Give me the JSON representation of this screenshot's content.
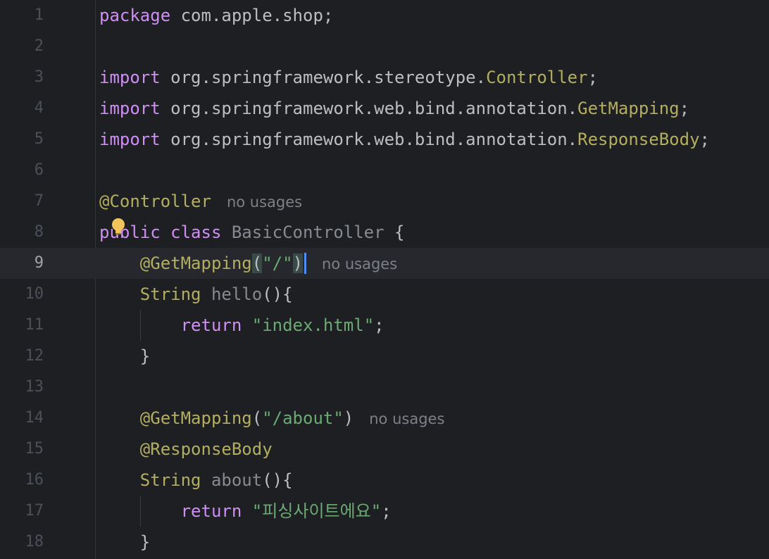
{
  "editor": {
    "current_line": 9,
    "lines": [
      {
        "n": "1",
        "parts": [
          [
            "kw",
            "package"
          ],
          [
            "plain",
            " com.apple.shop;"
          ]
        ]
      },
      {
        "n": "2",
        "parts": []
      },
      {
        "n": "3",
        "parts": [
          [
            "kw",
            "import"
          ],
          [
            "plain",
            " org.springframework.stereotype."
          ],
          [
            "ann",
            "Controller"
          ],
          [
            "plain",
            ";"
          ]
        ]
      },
      {
        "n": "4",
        "parts": [
          [
            "kw",
            "import"
          ],
          [
            "plain",
            " org.springframework.web.bind.annotation."
          ],
          [
            "ann",
            "GetMapping"
          ],
          [
            "plain",
            ";"
          ]
        ]
      },
      {
        "n": "5",
        "parts": [
          [
            "kw",
            "import"
          ],
          [
            "plain",
            " org.springframework.web.bind.annotation."
          ],
          [
            "ann",
            "ResponseBody"
          ],
          [
            "plain",
            ";"
          ]
        ]
      },
      {
        "n": "6",
        "parts": []
      },
      {
        "n": "7",
        "parts": [
          [
            "ann",
            "@Controller"
          ]
        ],
        "hint": "no usages"
      },
      {
        "n": "8",
        "parts": [
          [
            "kw",
            "public class "
          ],
          [
            "unused",
            "BasicController"
          ],
          [
            "plain",
            " {"
          ]
        ]
      },
      {
        "n": "9",
        "parts": [
          [
            "plain",
            "    "
          ],
          [
            "ann",
            "@GetMapping"
          ],
          [
            "brace",
            "("
          ],
          [
            "str",
            "\"/\""
          ],
          [
            "brace",
            ")"
          ]
        ],
        "hint": "no usages",
        "caret": true
      },
      {
        "n": "10",
        "parts": [
          [
            "plain",
            "    "
          ],
          [
            "ann",
            "String "
          ],
          [
            "unused",
            "hello"
          ],
          [
            "plain",
            "(){"
          ]
        ]
      },
      {
        "n": "11",
        "parts": [
          [
            "plain",
            "        "
          ],
          [
            "kw",
            "return "
          ],
          [
            "str",
            "\"index.html\""
          ],
          [
            "plain",
            ";"
          ]
        ]
      },
      {
        "n": "12",
        "parts": [
          [
            "plain",
            "    }"
          ]
        ]
      },
      {
        "n": "13",
        "parts": []
      },
      {
        "n": "14",
        "parts": [
          [
            "plain",
            "    "
          ],
          [
            "ann",
            "@GetMapping"
          ],
          [
            "plain",
            "("
          ],
          [
            "str",
            "\"/about\""
          ],
          [
            "plain",
            ")"
          ]
        ],
        "hint": "no usages"
      },
      {
        "n": "15",
        "parts": [
          [
            "plain",
            "    "
          ],
          [
            "ann",
            "@ResponseBody"
          ]
        ]
      },
      {
        "n": "16",
        "parts": [
          [
            "plain",
            "    "
          ],
          [
            "ann",
            "String "
          ],
          [
            "unused",
            "about"
          ],
          [
            "plain",
            "(){"
          ]
        ]
      },
      {
        "n": "17",
        "parts": [
          [
            "plain",
            "        "
          ],
          [
            "kw",
            "return "
          ],
          [
            "str",
            "\"피싱사이트에요\""
          ],
          [
            "plain",
            ";"
          ]
        ]
      },
      {
        "n": "18",
        "parts": [
          [
            "plain",
            "    }"
          ]
        ]
      }
    ]
  },
  "icons": {
    "intention_bulb": "lightbulb-icon"
  },
  "colors": {
    "background": "#1e1f22",
    "keyword": "#cf8ef4",
    "annotation": "#b3ae60",
    "string": "#6aab73",
    "caret": "#4f8cf7"
  }
}
